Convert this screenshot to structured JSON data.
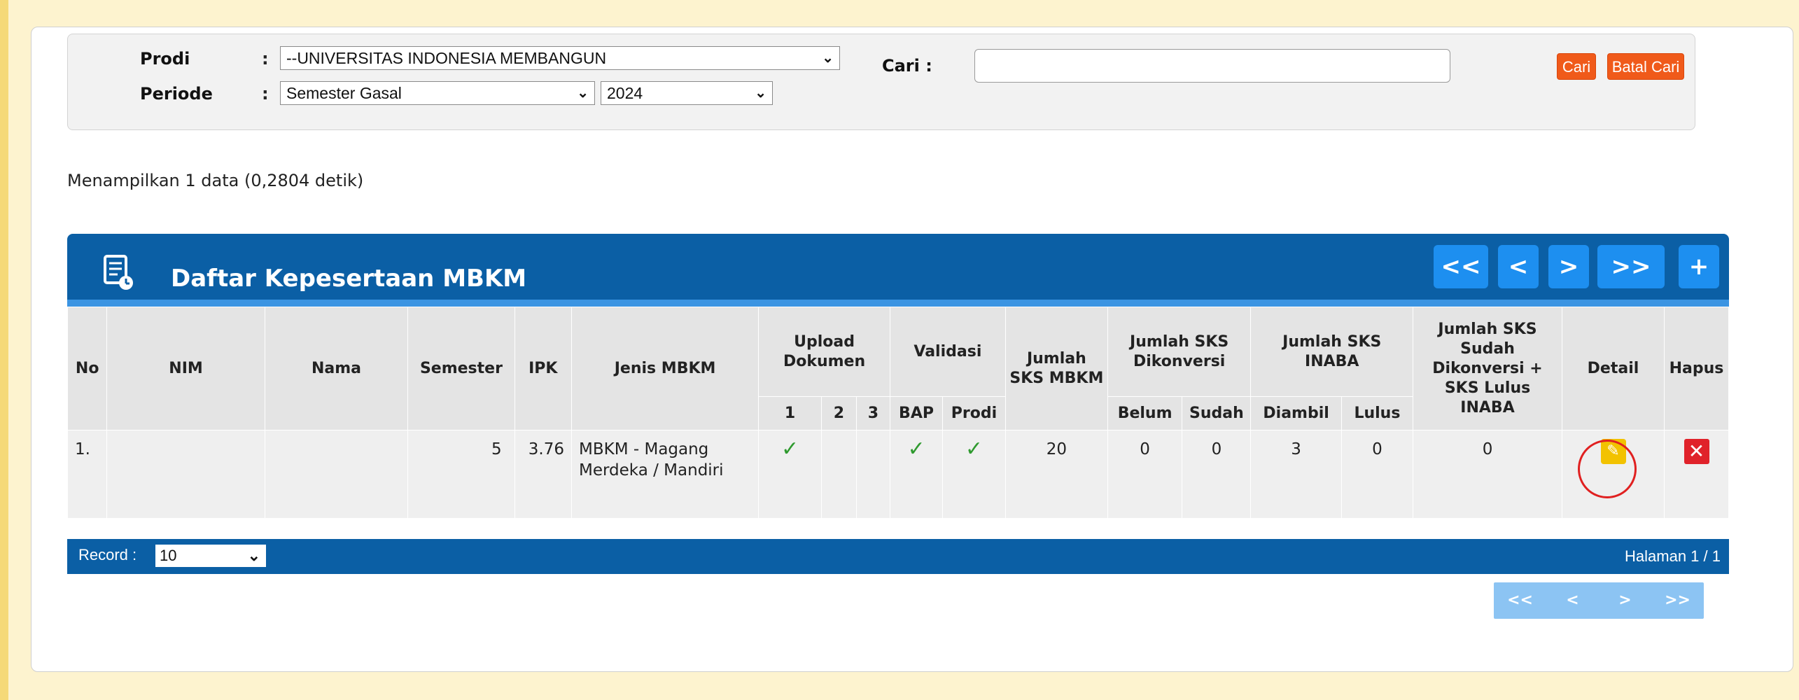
{
  "filter": {
    "prodi_label": "Prodi",
    "prodi_colon": ":",
    "prodi_value": "--UNIVERSITAS INDONESIA MEMBANGUN",
    "periode_label": "Periode",
    "periode_colon": ":",
    "semester_value": "Semester Gasal",
    "year_value": "2024",
    "search_label": "Cari :",
    "search_value": "",
    "search_button": "Cari",
    "cancel_search_button": "Batal Cari"
  },
  "info_text": "Menampilkan 1 data (0,2804 detik)",
  "table": {
    "title": "Daftar Kepesertaan MBKM",
    "nav": {
      "first": "<<",
      "prev": "<",
      "next": ">",
      "last": ">>",
      "add": "+"
    },
    "headers": {
      "no": "No",
      "nim": "NIM",
      "nama": "Nama",
      "semester": "Semester",
      "ipk": "IPK",
      "jenis": "Jenis MBKM",
      "upload": "Upload Dokumen",
      "upload_1": "1",
      "upload_2": "2",
      "upload_3": "3",
      "validasi": "Validasi",
      "validasi_bap": "BAP",
      "validasi_prodi": "Prodi",
      "jumlah_sks_mbkm": "Jumlah SKS MBKM",
      "jumlah_sks_dikonversi": "Jumlah SKS Dikonversi",
      "dikonversi_belum": "Belum",
      "dikonversi_sudah": "Sudah",
      "jumlah_sks_inaba": "Jumlah SKS INABA",
      "inaba_diambil": "Diambil",
      "inaba_lulus": "Lulus",
      "jumlah_total": "Jumlah SKS Sudah Dikonversi + SKS Lulus INABA",
      "detail": "Detail",
      "hapus": "Hapus"
    },
    "rows": [
      {
        "no": "1.",
        "nim": "",
        "nama": "",
        "semester": "5",
        "ipk": "3.76",
        "jenis": "MBKM - Magang Merdeka / Mandiri",
        "upload_1": true,
        "upload_2": false,
        "upload_3": false,
        "bap": true,
        "prodi": true,
        "sks_mbkm": "20",
        "belum": "0",
        "sudah": "0",
        "diambil": "3",
        "lulus": "0",
        "total": "0"
      }
    ],
    "footer": {
      "record_label": "Record :",
      "record_value": "10",
      "page_info": "Halaman 1 / 1"
    },
    "bottom_nav": {
      "first": "<<",
      "prev": "<",
      "next": ">",
      "last": ">>"
    }
  },
  "colors": {
    "header_blue": "#0b5fa5",
    "nav_blue": "#1d8ff0",
    "orange_button": "#f05a1a",
    "check_green": "#2f9a2f",
    "edit_yellow": "#f2c200",
    "delete_red": "#e0222a"
  },
  "icons": {
    "table_title": "document-list-icon",
    "check": "check-icon",
    "detail": "pencil-icon",
    "hapus": "close-icon",
    "dropdown": "chevron-down-icon"
  }
}
